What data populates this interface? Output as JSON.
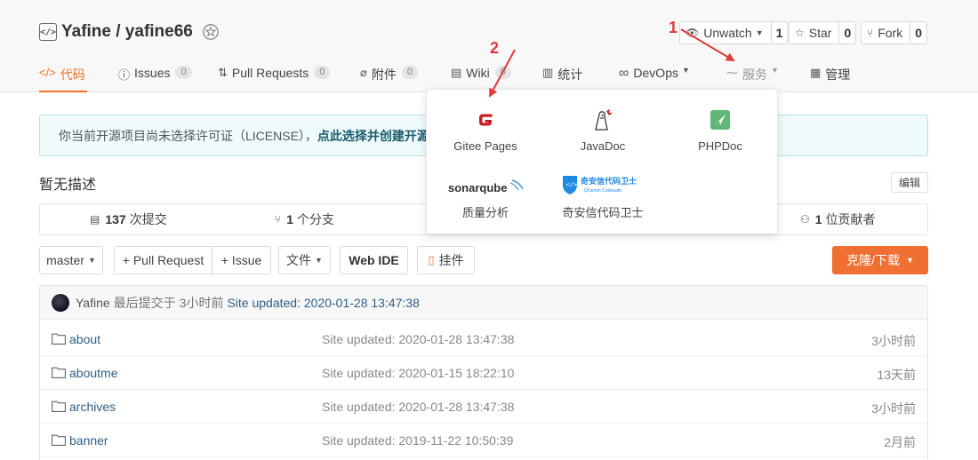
{
  "repo": {
    "owner_name": "Yafine / yafine66"
  },
  "actions": {
    "watch": {
      "label": "Unwatch",
      "count": "1"
    },
    "star": {
      "label": "Star",
      "count": "0"
    },
    "fork": {
      "label": "Fork",
      "count": "0"
    }
  },
  "tabs": [
    {
      "label": "代码",
      "count": null
    },
    {
      "label": "Issues",
      "count": "0"
    },
    {
      "label": "Pull Requests",
      "count": "0"
    },
    {
      "label": "附件",
      "count": "0"
    },
    {
      "label": "Wiki",
      "count": "0"
    },
    {
      "label": "统计",
      "count": null
    },
    {
      "label": "DevOps",
      "count": null
    },
    {
      "label": "服务",
      "count": null
    },
    {
      "label": "管理",
      "count": null
    }
  ],
  "notice": {
    "text": "你当前开源项目尚未选择许可证（LICENSE），",
    "link": "点此选择并创建开源"
  },
  "description": {
    "text": "暂无描述",
    "edit_label": "编辑"
  },
  "stats": {
    "commits_count": "137",
    "commits_label": "次提交",
    "branches_count": "1",
    "branches_label": "个分支",
    "contributors_count": "1",
    "contributors_label": "位贡献者"
  },
  "toolbar": {
    "branch": "master",
    "pull_request": "+ Pull Request",
    "issue": "+ Issue",
    "files": "文件",
    "web_ide": "Web IDE",
    "widgets": "挂件",
    "clone": "克隆/下载"
  },
  "last_commit": {
    "author": "Yafine",
    "prefix": "最后提交于",
    "time": "3小时前",
    "message": "Site updated: 2020-01-28 13:47:38"
  },
  "files": [
    {
      "name": "about",
      "message": "Site updated: 2020-01-28 13:47:38",
      "time": "3小时前"
    },
    {
      "name": "aboutme",
      "message": "Site updated: 2020-01-15 18:22:10",
      "time": "13天前"
    },
    {
      "name": "archives",
      "message": "Site updated: 2020-01-28 13:47:38",
      "time": "3小时前"
    },
    {
      "name": "banner",
      "message": "Site updated: 2019-11-22 10:50:39",
      "time": "2月前"
    }
  ],
  "service_menu": [
    {
      "label": "Gitee Pages",
      "icon": "gitee-pages-icon"
    },
    {
      "label": "JavaDoc",
      "icon": "javadoc-icon"
    },
    {
      "label": "PHPDoc",
      "icon": "phpdoc-icon"
    },
    {
      "label": "质量分析",
      "icon": "sonarqube-icon",
      "logo_text": "sonarqube"
    },
    {
      "label": "奇安信代码卫士",
      "icon": "qianxin-codesafe-icon",
      "logo_text": "奇安信代码卫士",
      "logo_subtext": "Qi'anxin Codesafe"
    }
  ],
  "annotations": [
    {
      "label": "1"
    },
    {
      "label": "2"
    }
  ],
  "colors": {
    "accent": "#f47024",
    "clone_button": "#f07033",
    "link": "#2d5f88",
    "annotation": "#e23a3a",
    "notice_bg": "#eefafb"
  }
}
